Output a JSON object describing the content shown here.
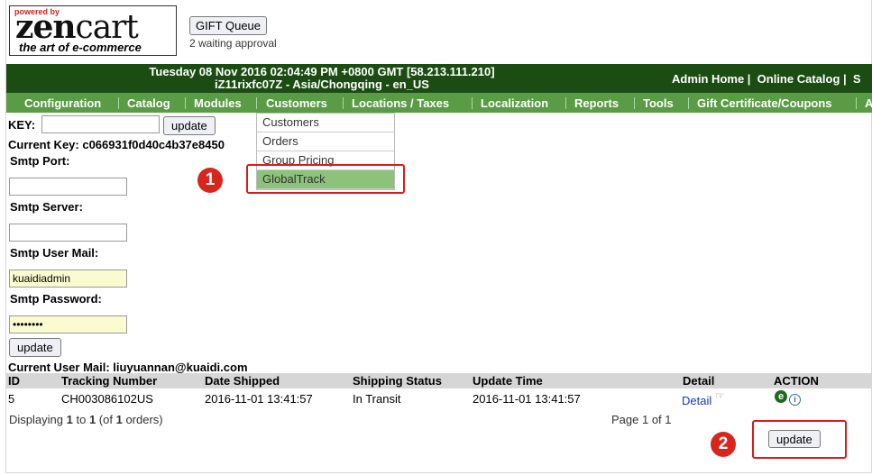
{
  "logo": {
    "powered_by": "powered by",
    "zen": "zen",
    "cart": "cart",
    "tagline": "the art of e-commerce"
  },
  "gift": {
    "button": "GIFT Queue",
    "waiting": "2 waiting approval"
  },
  "header": {
    "datetime": "Tuesday 08 Nov 2016 02:04:49 PM +0800 GMT [58.213.111.210]",
    "server": "iZ11rixfc07Z - Asia/Chongqing - en_US",
    "admin_home": "Admin Home",
    "online_catalog": "Online Catalog",
    "more": "S"
  },
  "menu": [
    "Configuration",
    "Catalog",
    "Modules",
    "Customers",
    "Locations / Taxes",
    "Localization",
    "Reports",
    "Tools",
    "Gift Certificate/Coupons",
    "A"
  ],
  "dropdown": [
    "Customers",
    "Orders",
    "Group Pricing",
    "GlobalTrack"
  ],
  "badges": {
    "one": "1",
    "two": "2"
  },
  "form": {
    "key_label": "KEY:",
    "key_value": "",
    "update": "update",
    "current_key": "Current Key: c066931f0d40c4b37e8450",
    "smtp_port": "Smtp Port:",
    "smtp_server": "Smtp Server:",
    "smtp_user": "Smtp User Mail:",
    "smtp_user_value": "kuaidiadmin",
    "smtp_password": "Smtp Password:",
    "smtp_password_value": "••••••••",
    "current_user": "Current User Mail: liuyuannan@kuaidi.com"
  },
  "table": {
    "headers": [
      "ID",
      "Tracking Number",
      "Date Shipped",
      "Shipping Status",
      "Update Time",
      "Detail",
      "ACTION"
    ],
    "rows": [
      {
        "id": "5",
        "tracking": "CH003086102US",
        "shipped": "2016-11-01 13:41:57",
        "status": "In Transit",
        "updated": "2016-11-01 13:41:57",
        "detail": "Detail"
      }
    ],
    "action_icons": [
      "edit-icon",
      "info-icon"
    ],
    "displaying": "Displaying",
    "from": "1",
    "to_word": "to",
    "to": "1",
    "of_prefix": "(of",
    "total": "1",
    "of_suffix": "orders)",
    "page": "Page 1 of 1",
    "update": "update"
  }
}
